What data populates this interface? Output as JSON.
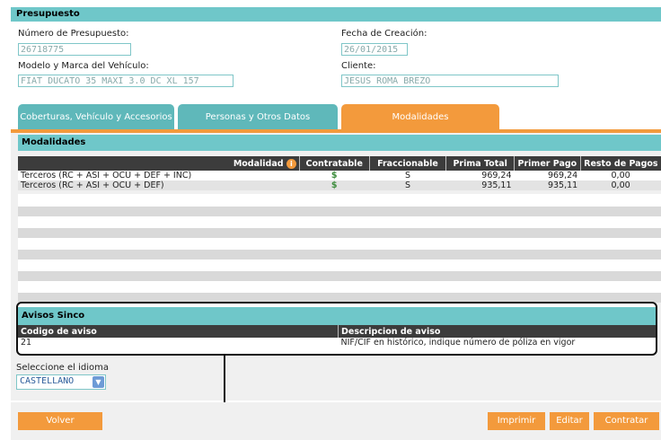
{
  "section_title": "Presupuesto",
  "budget_number": {
    "label": "Número de Presupuesto:",
    "value": "26718775"
  },
  "creation_date": {
    "label": "Fecha de Creación:",
    "value": "26/01/2015"
  },
  "vehicle": {
    "label": "Modelo y Marca del Vehículo:",
    "value": "FIAT DUCATO 35 MAXI 3.0 DC XL 157"
  },
  "client": {
    "label": "Cliente:",
    "value": "JESUS ROMA BREZO"
  },
  "tabs": [
    {
      "label": "Coberturas, Vehículo y Accesorios"
    },
    {
      "label": "Personas y Otros Datos"
    },
    {
      "label": "Modalidades"
    }
  ],
  "modalidades": {
    "title": "Modalidades",
    "columns": [
      "Modalidad",
      "Contratable",
      "Fraccionable",
      "Prima Total",
      "Primer Pago",
      "Resto de Pagos"
    ],
    "info_icon": "info-icon",
    "rows": [
      {
        "modalidad": "Terceros (RC + ASI + OCU + DEF + INC)",
        "contratable": "$",
        "fraccionable": "S",
        "prima_total": "969,24",
        "primer_pago": "969,24",
        "resto": "0,00"
      },
      {
        "modalidad": "Terceros (RC + ASI + OCU + DEF)",
        "contratable": "$",
        "fraccionable": "S",
        "prima_total": "935,11",
        "primer_pago": "935,11",
        "resto": "0,00"
      }
    ]
  },
  "avisos": {
    "title": "Avisos Sinco",
    "columns": [
      "Codigo de aviso",
      "Descripcion de aviso"
    ],
    "rows": [
      {
        "codigo": "21",
        "descripcion": "NIF/CIF en histórico, indique número de póliza en vigor"
      }
    ]
  },
  "language": {
    "label": "Seleccione el idioma",
    "selected": "CASTELLANO"
  },
  "buttons": {
    "volver": "Volver",
    "imprimir": "Imprimir",
    "editar": "Editar",
    "contratar": "Contratar"
  },
  "colors": {
    "teal": "#6fc7c9",
    "orange": "#f39a3c",
    "dark": "#3c3c3c"
  }
}
